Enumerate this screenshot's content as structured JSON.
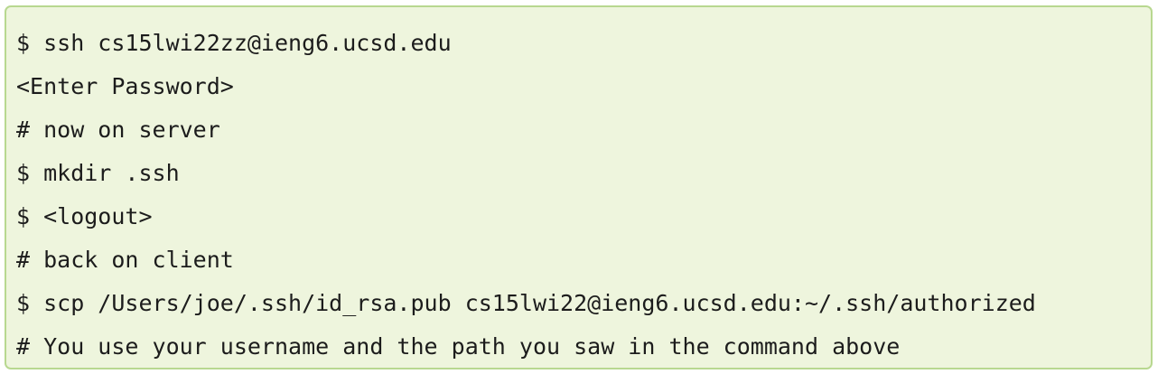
{
  "code_block": {
    "lines": [
      "$ ssh cs15lwi22zz@ieng6.ucsd.edu",
      "<Enter Password>",
      "# now on server",
      "$ mkdir .ssh",
      "$ <logout>",
      "# back on client",
      "$ scp /Users/joe/.ssh/id_rsa.pub cs15lwi22@ieng6.ucsd.edu:~/.ssh/authorized",
      "# You use your username and the path you saw in the command above"
    ]
  },
  "colors": {
    "background": "#eef5dd",
    "border": "#b8d890",
    "text": "#1c1c1c"
  }
}
